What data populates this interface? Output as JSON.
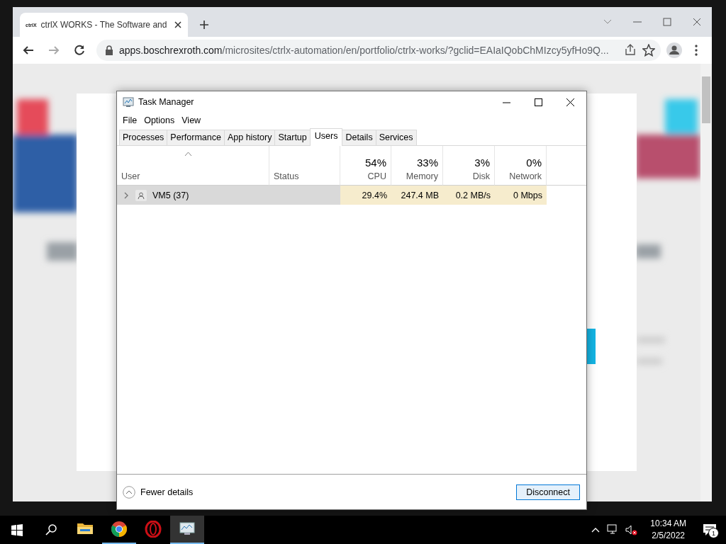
{
  "browser": {
    "tab": {
      "favicon": "ctrlX",
      "title": "ctrlX WORKS - The Software and",
      "selected": true
    },
    "address": {
      "host": "apps.boschrexroth.com",
      "path": "/microsites/ctrlx-automation/en/portfolio/ctrlx-works/?gclid=EAIaIQobChMIzcy5yfHo9Q..."
    }
  },
  "task_manager": {
    "title": "Task Manager",
    "menu": [
      "File",
      "Options",
      "View"
    ],
    "tabs": [
      {
        "label": "Processes",
        "selected": false
      },
      {
        "label": "Performance",
        "selected": false
      },
      {
        "label": "App history",
        "selected": false
      },
      {
        "label": "Startup",
        "selected": false
      },
      {
        "label": "Users",
        "selected": true
      },
      {
        "label": "Details",
        "selected": false
      },
      {
        "label": "Services",
        "selected": false
      }
    ],
    "columns": [
      {
        "label": "User",
        "kind": "text",
        "sorted": true
      },
      {
        "label": "Status",
        "kind": "text",
        "sorted": false
      },
      {
        "label": "CPU",
        "kind": "metric",
        "summary": "54%",
        "sorted": false
      },
      {
        "label": "Memory",
        "kind": "metric",
        "summary": "33%",
        "sorted": false
      },
      {
        "label": "Disk",
        "kind": "metric",
        "summary": "3%",
        "sorted": false
      },
      {
        "label": "Network",
        "kind": "metric",
        "summary": "0%",
        "sorted": false
      }
    ],
    "rows": [
      {
        "user": "VM5 (37)",
        "selected": true,
        "expanded": false,
        "values": [
          "29.4%",
          "247.4 MB",
          "0.2 MB/s",
          "0 Mbps"
        ]
      }
    ],
    "fewer_details": "Fewer details",
    "disconnect": "Disconnect"
  },
  "taskbar": {
    "apps": [
      {
        "kind": "explorer",
        "running": false,
        "selected": false
      },
      {
        "kind": "chrome",
        "running": true,
        "selected": false
      },
      {
        "kind": "opera",
        "running": false,
        "selected": false
      },
      {
        "kind": "taskmgr",
        "running": true,
        "selected": true
      }
    ],
    "time": "10:34 AM",
    "date": "2/5/2022",
    "notifications": "1"
  }
}
